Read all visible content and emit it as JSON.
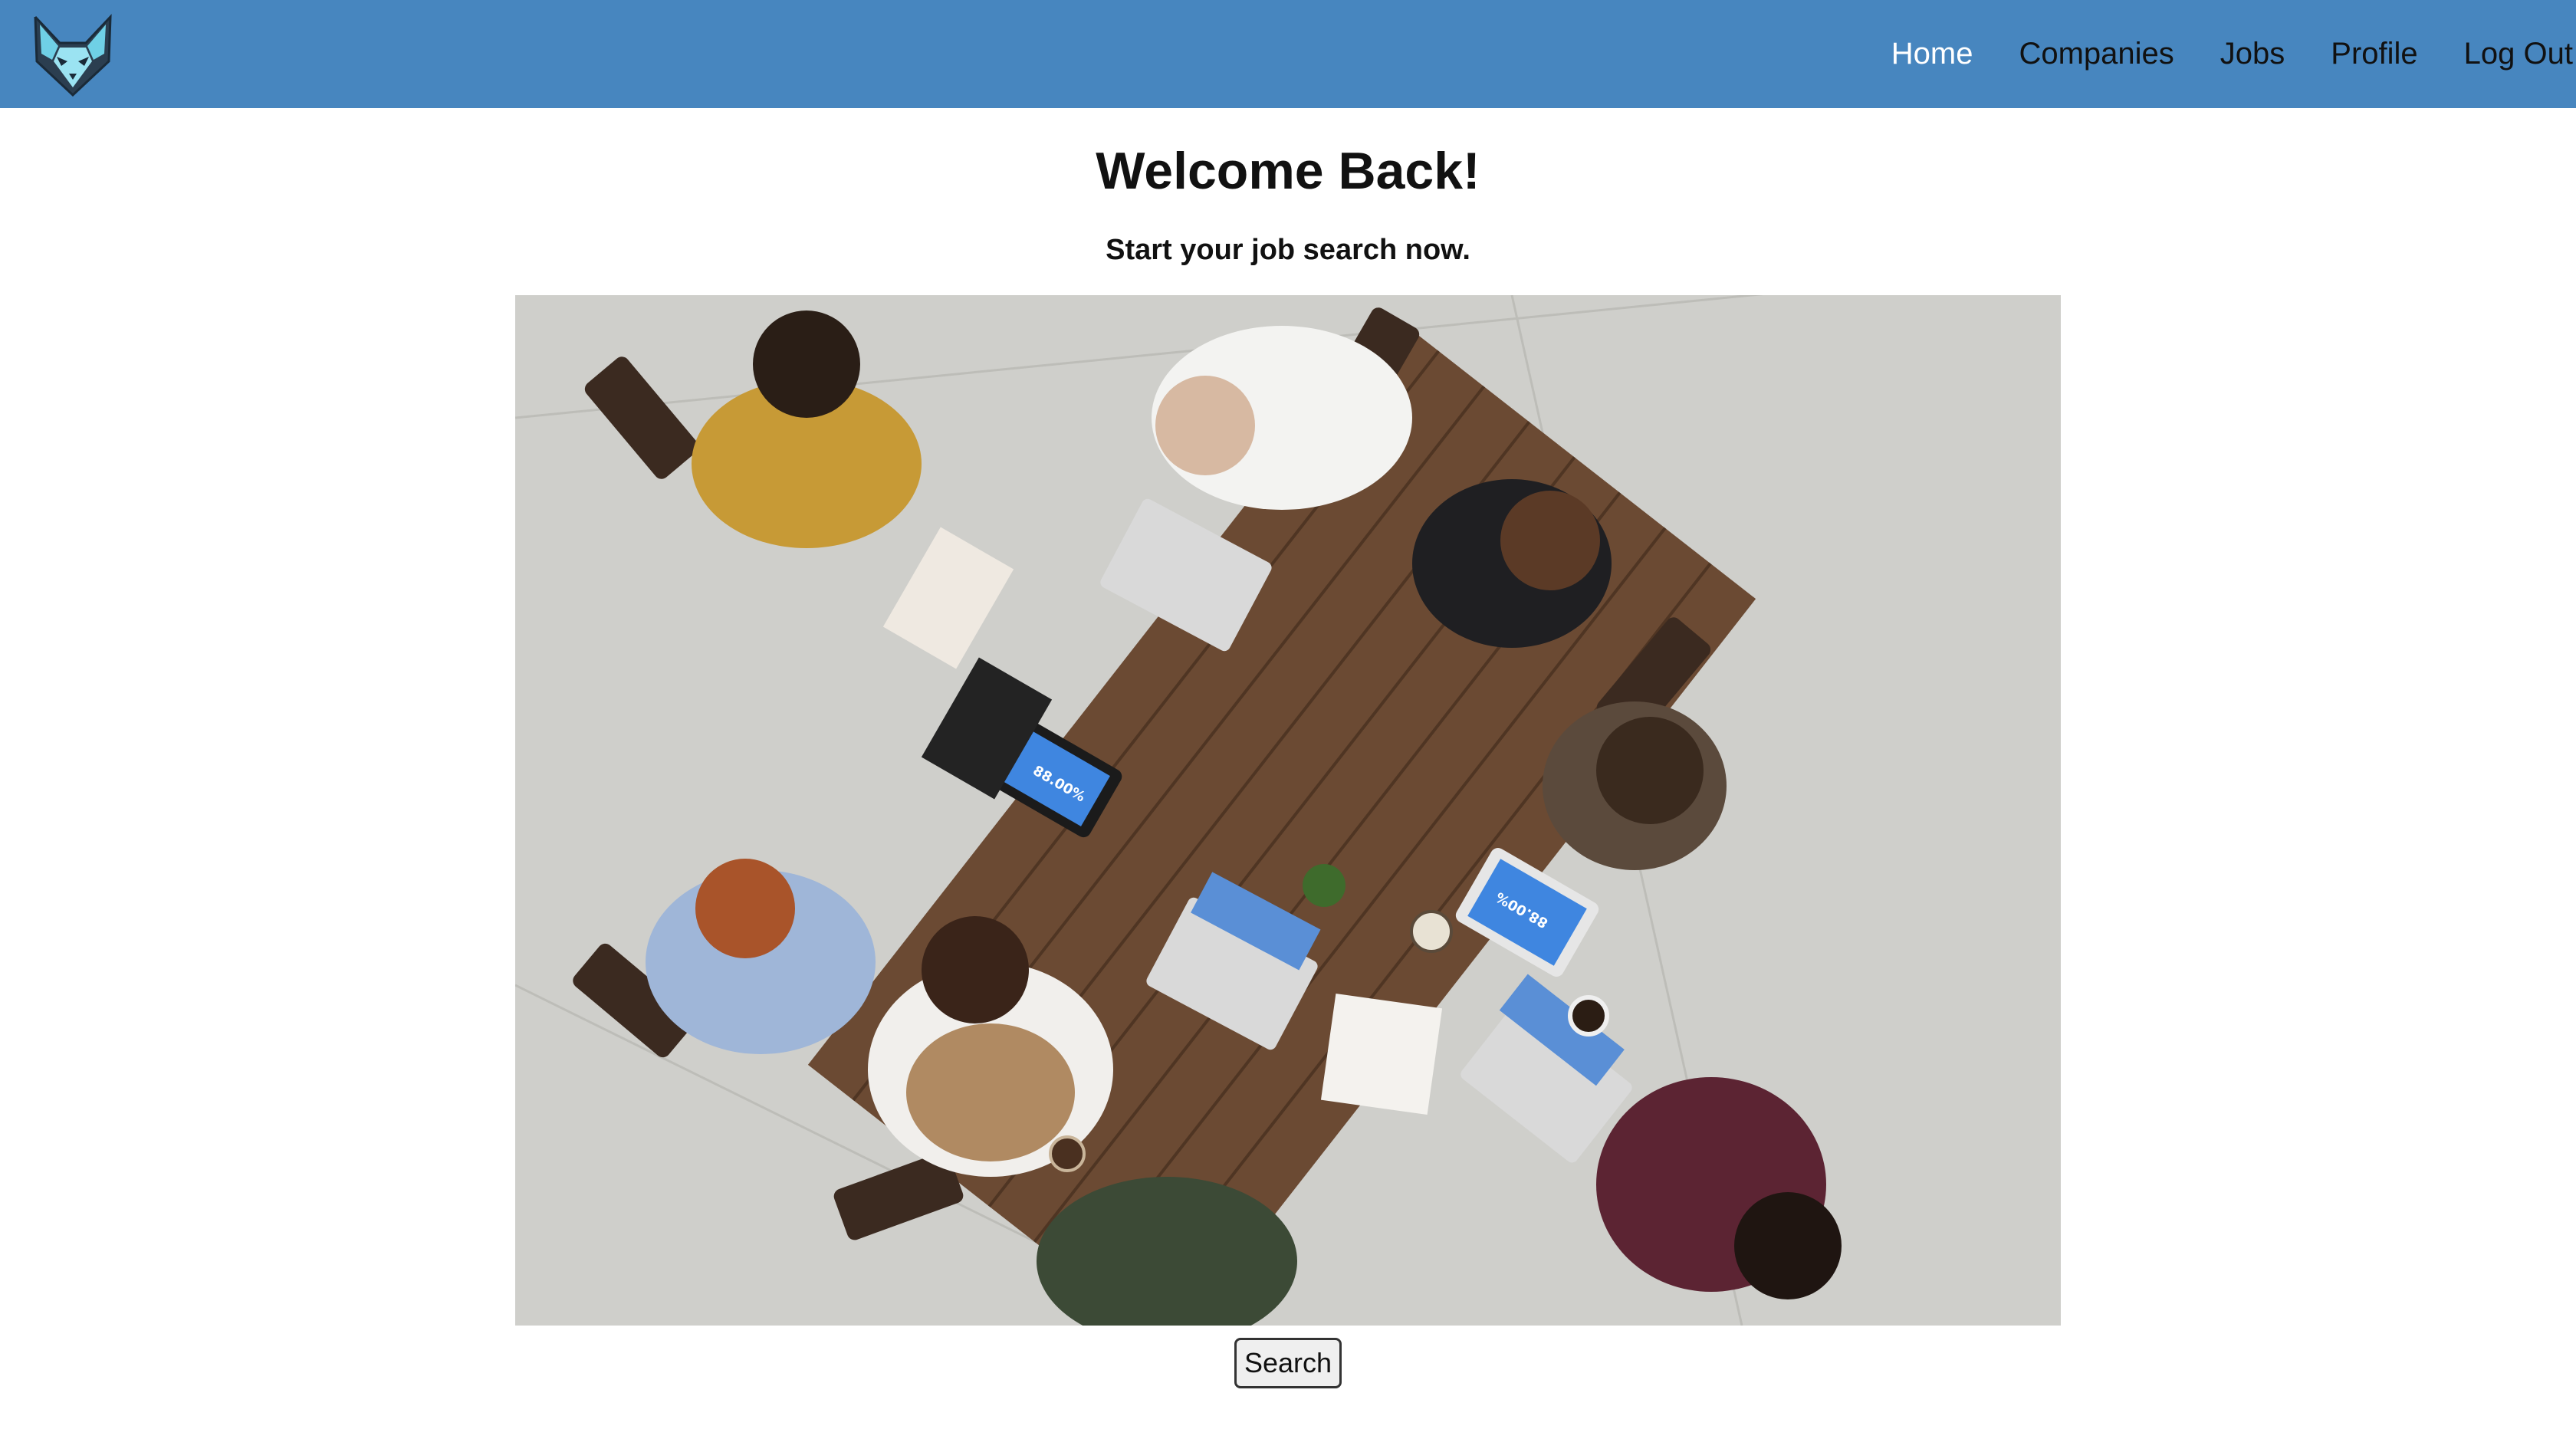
{
  "nav": {
    "links": [
      {
        "label": "Home"
      },
      {
        "label": "Companies"
      },
      {
        "label": "Jobs"
      },
      {
        "label": "Profile"
      },
      {
        "label": "Log Out"
      }
    ],
    "logo_icon": "cat-head-icon",
    "background_color": "#4786bf",
    "active_link_color": "#ffffff"
  },
  "main": {
    "title": "Welcome Back!",
    "subtitle": "Start your job search now.",
    "hero_image": {
      "icon": "team-meeting-photo",
      "screen_text": [
        "88.00%",
        "88.00%"
      ]
    },
    "search_button_label": "Search"
  }
}
